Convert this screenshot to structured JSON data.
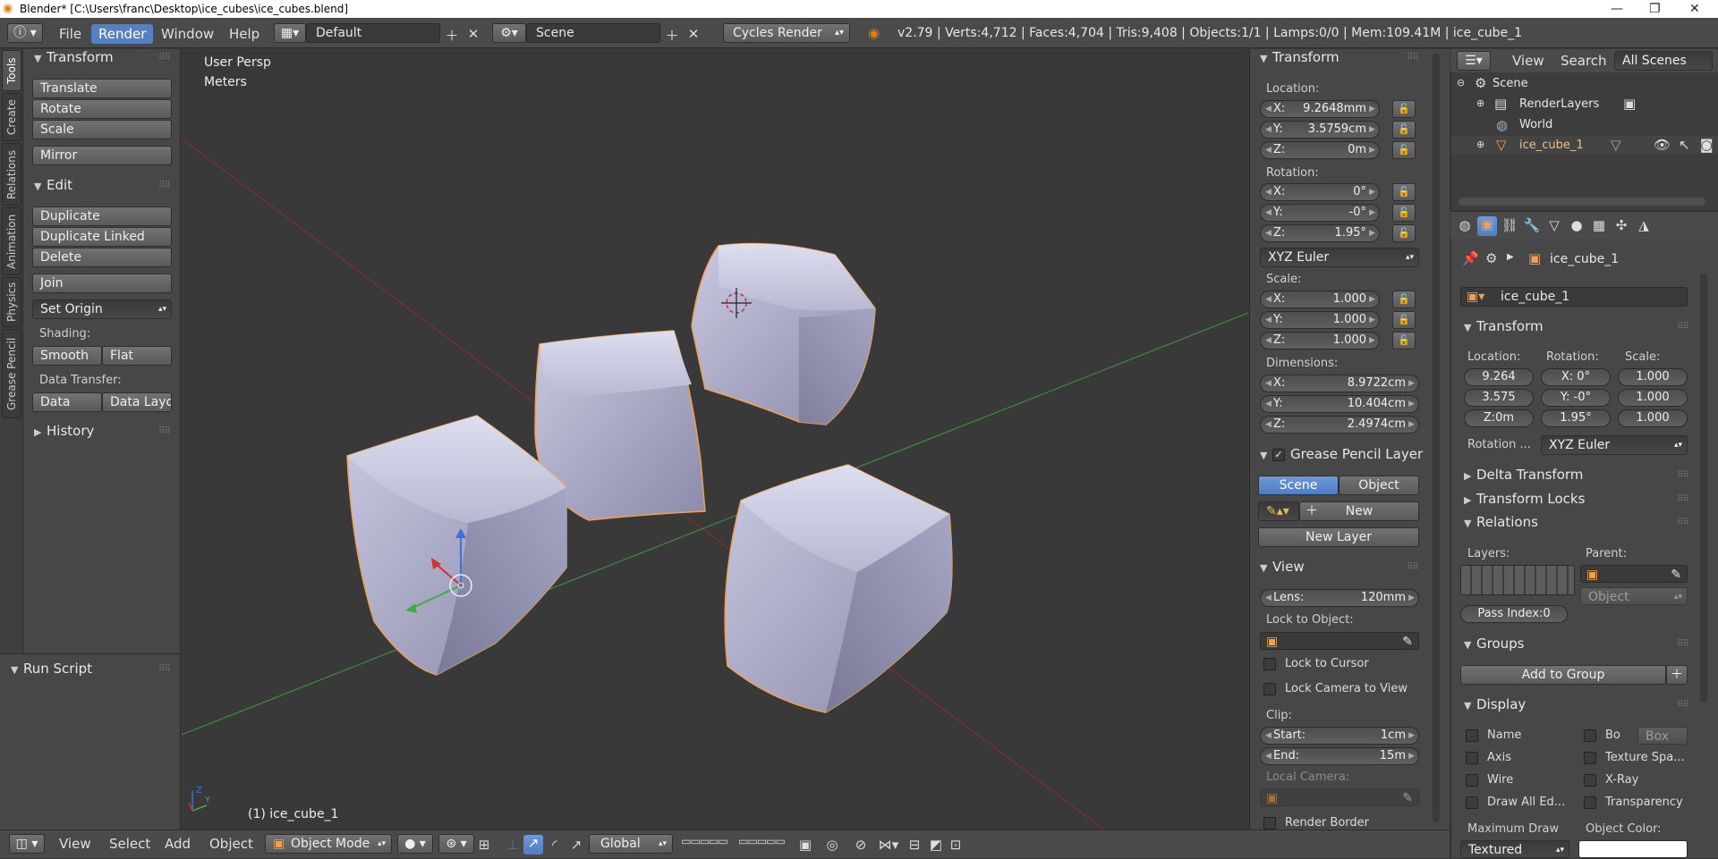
{
  "window": {
    "title": "Blender* [C:\\Users\\franc\\Desktop\\ice_cubes\\ice_cubes.blend]"
  },
  "menu": {
    "file": "File",
    "render": "Render",
    "window": "Window",
    "help": "Help"
  },
  "screen_layout": "Default",
  "scene_name": "Scene",
  "render_engine": "Cycles Render",
  "stats": "v2.79 | Verts:4,712 | Faces:4,704 | Tris:9,408 | Objects:1/1 | Lamps:0/0 | Mem:109.41M | ice_cube_1",
  "tabs": [
    "Tools",
    "Create",
    "Relations",
    "Animation",
    "Physics",
    "Grease Pencil"
  ],
  "tools": {
    "transform_header": "Transform",
    "translate": "Translate",
    "rotate": "Rotate",
    "scale": "Scale",
    "mirror": "Mirror",
    "edit_header": "Edit",
    "duplicate": "Duplicate",
    "duplicate_linked": "Duplicate Linked",
    "delete": "Delete",
    "join": "Join",
    "set_origin": "Set Origin",
    "shading_label": "Shading:",
    "smooth": "Smooth",
    "flat": "Flat",
    "data_transfer_label": "Data Transfer:",
    "data": "Data",
    "data_layout": "Data Layo",
    "history_header": "History"
  },
  "operator": {
    "header": "Run Script"
  },
  "viewport": {
    "persp": "User Persp",
    "units": "Meters",
    "object_label": "(1) ice_cube_1",
    "view": "View",
    "select": "Select",
    "add": "Add",
    "object": "Object",
    "mode": "Object Mode",
    "orientation": "Global"
  },
  "n_panel": {
    "transform_header": "Transform",
    "location_label": "Location:",
    "loc": [
      {
        "axis": "X:",
        "value": "9.2648mm"
      },
      {
        "axis": "Y:",
        "value": "3.5759cm"
      },
      {
        "axis": "Z:",
        "value": "0m"
      }
    ],
    "rotation_label": "Rotation:",
    "rot": [
      {
        "axis": "X:",
        "value": "0°"
      },
      {
        "axis": "Y:",
        "value": "-0°"
      },
      {
        "axis": "Z:",
        "value": "1.95°"
      }
    ],
    "rotation_mode": "XYZ Euler",
    "scale_label": "Scale:",
    "scl": [
      {
        "axis": "X:",
        "value": "1.000"
      },
      {
        "axis": "Y:",
        "value": "1.000"
      },
      {
        "axis": "Z:",
        "value": "1.000"
      }
    ],
    "dimensions_label": "Dimensions:",
    "dim": [
      {
        "axis": "X:",
        "value": "8.9722cm"
      },
      {
        "axis": "Y:",
        "value": "10.404cm"
      },
      {
        "axis": "Z:",
        "value": "2.4974cm"
      }
    ],
    "gp_header": "Grease Pencil Layer",
    "gp_scene": "Scene",
    "gp_object": "Object",
    "gp_new": "New",
    "gp_new_layer": "New Layer",
    "view_header": "View",
    "lens_label": "Lens:",
    "lens_value": "120mm",
    "lock_to_object": "Lock to Object:",
    "lock_to_cursor": "Lock to Cursor",
    "lock_camera": "Lock Camera to View",
    "clip_label": "Clip:",
    "clip_start_label": "Start:",
    "clip_start": "1cm",
    "clip_end_label": "End:",
    "clip_end": "15m",
    "local_camera": "Local Camera:",
    "render_border": "Render Border"
  },
  "outliner": {
    "view": "View",
    "search": "Search",
    "filter": "All Scenes",
    "items": [
      "Scene",
      "RenderLayers",
      "World",
      "ice_cube_1"
    ]
  },
  "properties": {
    "object_name_path": "ice_cube_1",
    "object_name": "ice_cube_1",
    "transform_header": "Transform",
    "location_label": "Location:",
    "rotation_label": "Rotation:",
    "scale_label": "Scale:",
    "loc": [
      "9.264",
      "3.575",
      "Z:0m"
    ],
    "rot": [
      "X:  0°",
      "Y: -0°",
      "1.95°"
    ],
    "scl": [
      "1.000",
      "1.000",
      "1.000"
    ],
    "rotation_mode_label": "Rotation ...",
    "rotation_mode": "XYZ Euler",
    "delta_header": "Delta Transform",
    "locks_header": "Transform Locks",
    "relations_header": "Relations",
    "layers_label": "Layers:",
    "parent_label": "Parent:",
    "parent_type": "Object",
    "pass_index": "Pass Index:0",
    "groups_header": "Groups",
    "add_to_group": "Add to Group",
    "display_header": "Display",
    "name": "Name",
    "bo": "Bo",
    "box": "Box",
    "axis": "Axis",
    "texture_space": "Texture Spa...",
    "wire": "Wire",
    "xray": "X-Ray",
    "draw_all": "Draw All Ed...",
    "transparency": "Transparency",
    "max_draw_label": "Maximum Draw",
    "max_draw": "Textured",
    "object_color_label": "Object Color:"
  },
  "colors": {
    "accent": "#5680c2",
    "selection": "#f0a050",
    "x_axis": "#b03030",
    "y_axis": "#3fae3f",
    "z_axis": "#3f6fdf"
  }
}
